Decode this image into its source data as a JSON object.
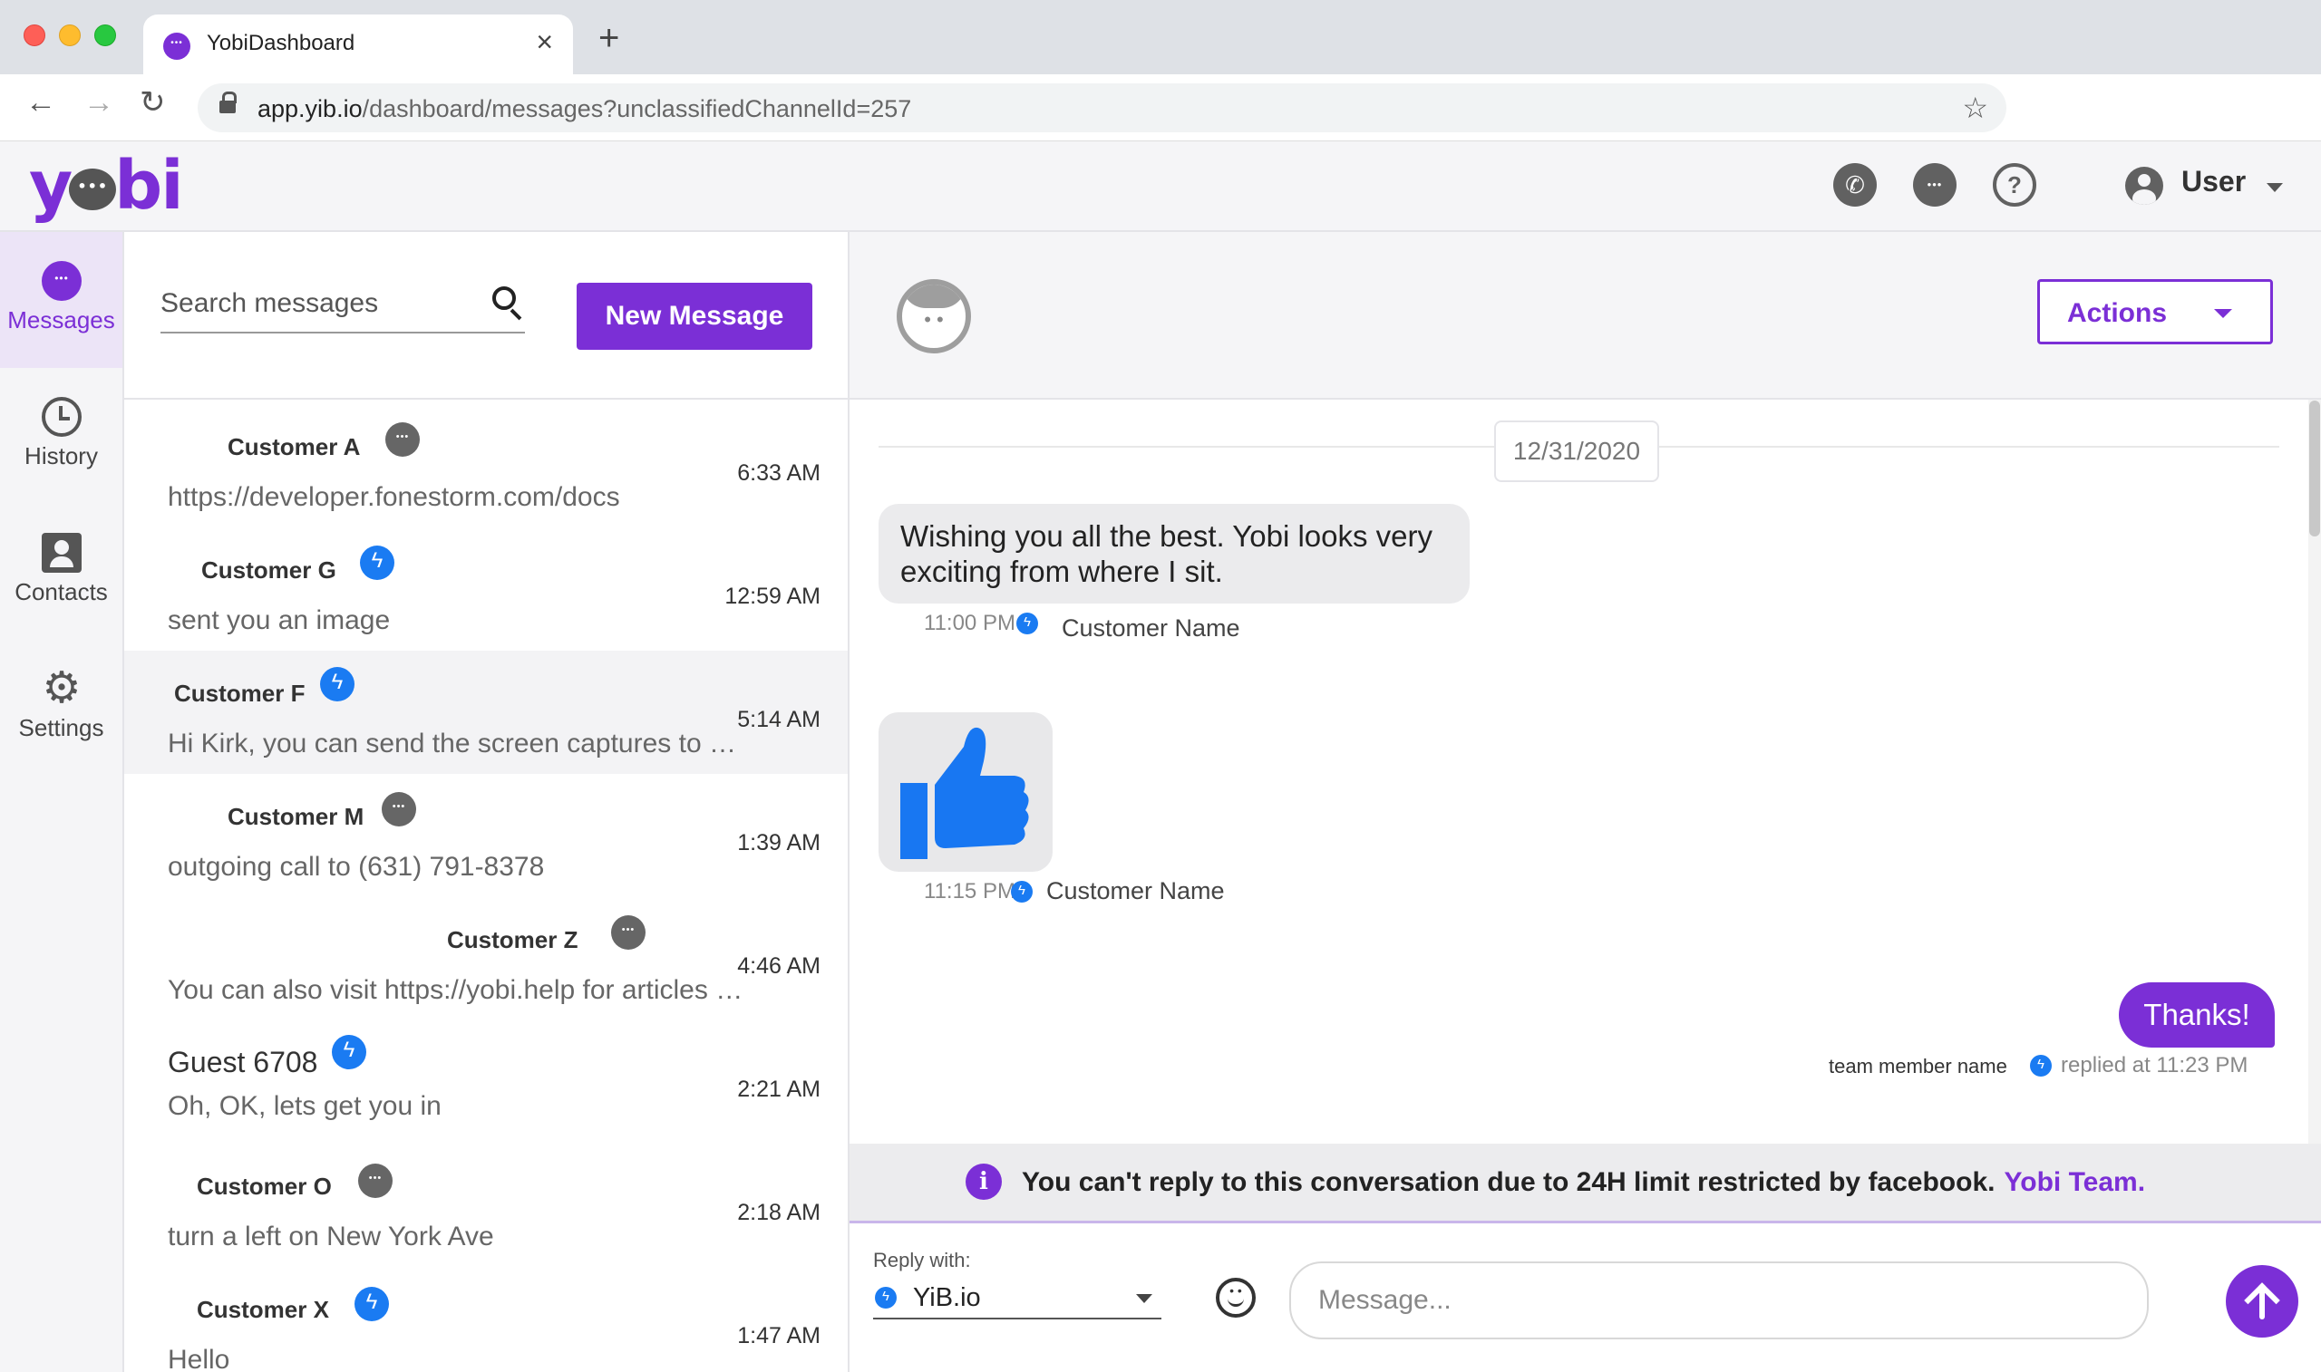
{
  "browser": {
    "tab_title": "YobiDashboard",
    "url_host": "app.yib.io",
    "url_path": "/dashboard/messages?unclassifiedChannelId=257"
  },
  "header": {
    "logo_left": "y",
    "logo_right": "bi",
    "user_name": "User"
  },
  "sidenav": {
    "items": [
      {
        "label": "Messages",
        "icon": "message-icon",
        "active": true
      },
      {
        "label": "History",
        "icon": "history-icon"
      },
      {
        "label": "Contacts",
        "icon": "contacts-icon"
      },
      {
        "label": "Settings",
        "icon": "gear-icon"
      }
    ]
  },
  "list": {
    "search_placeholder": "Search messages",
    "new_message_label": "New Message",
    "conversations": [
      {
        "name": "Customer A",
        "channel": "sms",
        "snippet": "https://developer.fonestorm.com/docs",
        "time": "6:33 AM"
      },
      {
        "name": "Customer G",
        "channel": "messenger",
        "snippet": "sent you an image",
        "time": "12:59 AM"
      },
      {
        "name": "Customer F",
        "channel": "messenger",
        "snippet": "Hi Kirk, you can send the screen captures to support@yobi.app and we will review",
        "time": "5:14 AM",
        "selected": true
      },
      {
        "name": "Customer M",
        "channel": "sms",
        "snippet": "outgoing call to (631) 791-8378",
        "time": "1:39 AM"
      },
      {
        "name": "Customer Z",
        "channel": "sms",
        "snippet": "You can also visit https://yobi.help for articles and tutorials",
        "time": "4:46 AM"
      },
      {
        "name": "Guest 6708",
        "channel": "messenger",
        "snippet": "Oh, OK, lets get you in",
        "time": "2:21 AM"
      },
      {
        "name": "Customer O",
        "channel": "sms",
        "snippet": "turn a left on New York Ave",
        "time": "2:18 AM"
      },
      {
        "name": "Customer X",
        "channel": "messenger",
        "snippet": "Hello",
        "time": "1:47 AM"
      }
    ]
  },
  "chat": {
    "actions_label": "Actions",
    "date": "12/31/2020",
    "messages": [
      {
        "text": "Wishing you all the best. Yobi looks very exciting from where I sit.",
        "time": "11:00 PM",
        "sender": "Customer Name"
      },
      {
        "time": "11:15 PM",
        "sender": "Customer Name",
        "attachment": "thumbs-up"
      },
      {
        "text": "Thanks!",
        "team_member": "team member name",
        "replied": "replied at 11:23 PM"
      }
    ],
    "notice_text": "You can't reply to this conversation due to 24H limit restricted by facebook.",
    "notice_link": "Yobi Team.",
    "reply_with_label": "Reply with:",
    "reply_with_value": "YiB.io",
    "message_placeholder": "Message..."
  },
  "colors": {
    "brand": "#7b2fd6",
    "messenger": "#1a7bf2",
    "thumb": "#1877f2"
  }
}
